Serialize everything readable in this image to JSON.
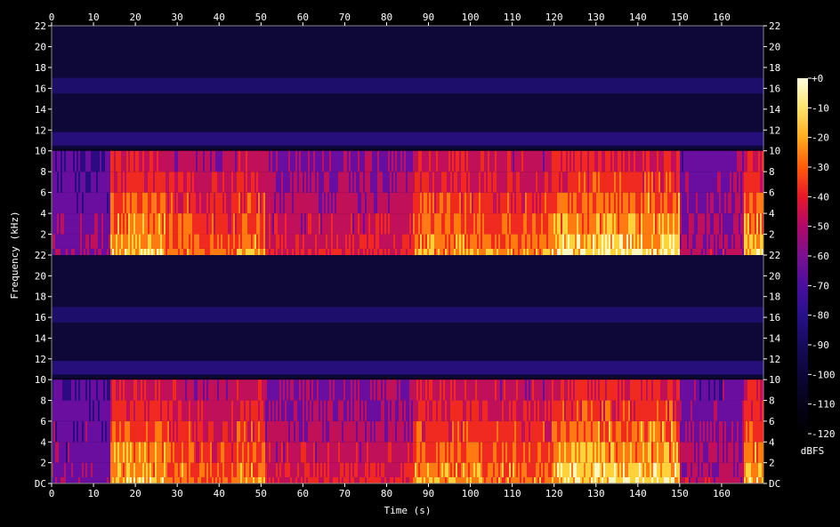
{
  "chart_data": {
    "type": "heatmap",
    "title": "",
    "xlabel": "Time (s)",
    "ylabel": "Frequency (kHz)",
    "xlim": [
      0,
      170
    ],
    "ylim_khz": [
      0,
      22
    ],
    "x_ticks": [
      0,
      10,
      20,
      30,
      40,
      50,
      60,
      70,
      80,
      90,
      100,
      110,
      120,
      130,
      140,
      150,
      160
    ],
    "y_ticks": [
      {
        "value": 0,
        "label": "DC"
      },
      {
        "value": 2,
        "label": "2"
      },
      {
        "value": 4,
        "label": "4"
      },
      {
        "value": 6,
        "label": "6"
      },
      {
        "value": 8,
        "label": "8"
      },
      {
        "value": 10,
        "label": "10"
      },
      {
        "value": 12,
        "label": "12"
      },
      {
        "value": 14,
        "label": "14"
      },
      {
        "value": 16,
        "label": "16"
      },
      {
        "value": 18,
        "label": "18"
      },
      {
        "value": 20,
        "label": "20"
      },
      {
        "value": 22,
        "label": "22"
      }
    ],
    "channels": 2,
    "colorbar": {
      "label": "dBFS",
      "range": [
        -120,
        0
      ],
      "ticks": [
        "+0",
        "-10",
        "-20",
        "-30",
        "-40",
        "-50",
        "-60",
        "-70",
        "-80",
        "-90",
        "-100",
        "-110",
        "-120"
      ],
      "colors": [
        "#fffde0",
        "#ffe36a",
        "#ffab1e",
        "#ff5b0a",
        "#e8172a",
        "#b0086a",
        "#7a1090",
        "#4a0ea0",
        "#28108a",
        "#160a5c",
        "#0c0638",
        "#050218",
        "#000000"
      ]
    },
    "segments": [
      {
        "start": 0,
        "end": 14,
        "level": 0.35
      },
      {
        "start": 14,
        "end": 27,
        "level": 0.85
      },
      {
        "start": 27,
        "end": 34,
        "level": 0.75
      },
      {
        "start": 34,
        "end": 44,
        "level": 0.7
      },
      {
        "start": 44,
        "end": 51,
        "level": 0.8
      },
      {
        "start": 51,
        "end": 86,
        "level": 0.55
      },
      {
        "start": 86,
        "end": 104,
        "level": 0.8
      },
      {
        "start": 104,
        "end": 119,
        "level": 0.75
      },
      {
        "start": 119,
        "end": 150,
        "level": 0.9
      },
      {
        "start": 150,
        "end": 165,
        "level": 0.45
      },
      {
        "start": 165,
        "end": 170,
        "level": 0.85
      }
    ],
    "cutoff_khz": 10
  }
}
